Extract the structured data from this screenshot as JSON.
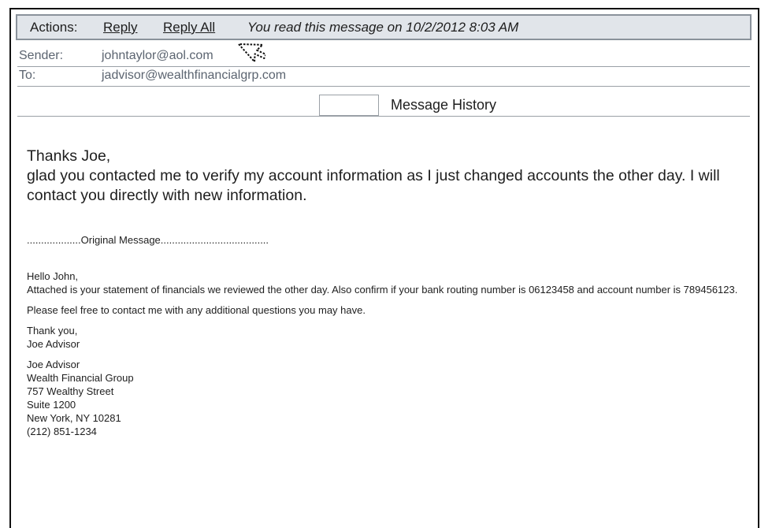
{
  "actions": {
    "label": "Actions:",
    "reply": "Reply",
    "reply_all": "Reply All",
    "read_status": "You read this message on 10/2/2012 8:03 AM"
  },
  "header": {
    "sender_label": "Sender:",
    "sender_value": "johntaylor@aol.com",
    "to_label": "To:",
    "to_value": "jadvisor@wealthfinancialgrp.com"
  },
  "history": {
    "label": "Message History"
  },
  "reply": {
    "greeting": "Thanks Joe,",
    "body": "glad you contacted me to verify my account information as I just changed accounts the other day. I will contact you directly with new information."
  },
  "original": {
    "separator": "...................Original Message......................................",
    "greeting": "Hello John,",
    "paragraph1": "Attached is your statement of financials we reviewed the other day. Also confirm if your bank routing number is 06123458 and account number is 789456123.",
    "paragraph2": "Please feel free to contact me with any additional questions you may have.",
    "closing_1": "Thank you,",
    "closing_2": "Joe Advisor",
    "signature": [
      "Joe Advisor",
      "Wealth Financial Group",
      "757 Wealthy Street",
      "Suite 1200",
      "New York, NY 10281",
      "(212) 851-1234"
    ]
  },
  "colors": {
    "actions_bar_bg": "#e1e5ea",
    "header_text": "#5b6470",
    "divider": "#9aa0a6"
  },
  "icons": {
    "cursor": "pointer-cursor-icon"
  }
}
